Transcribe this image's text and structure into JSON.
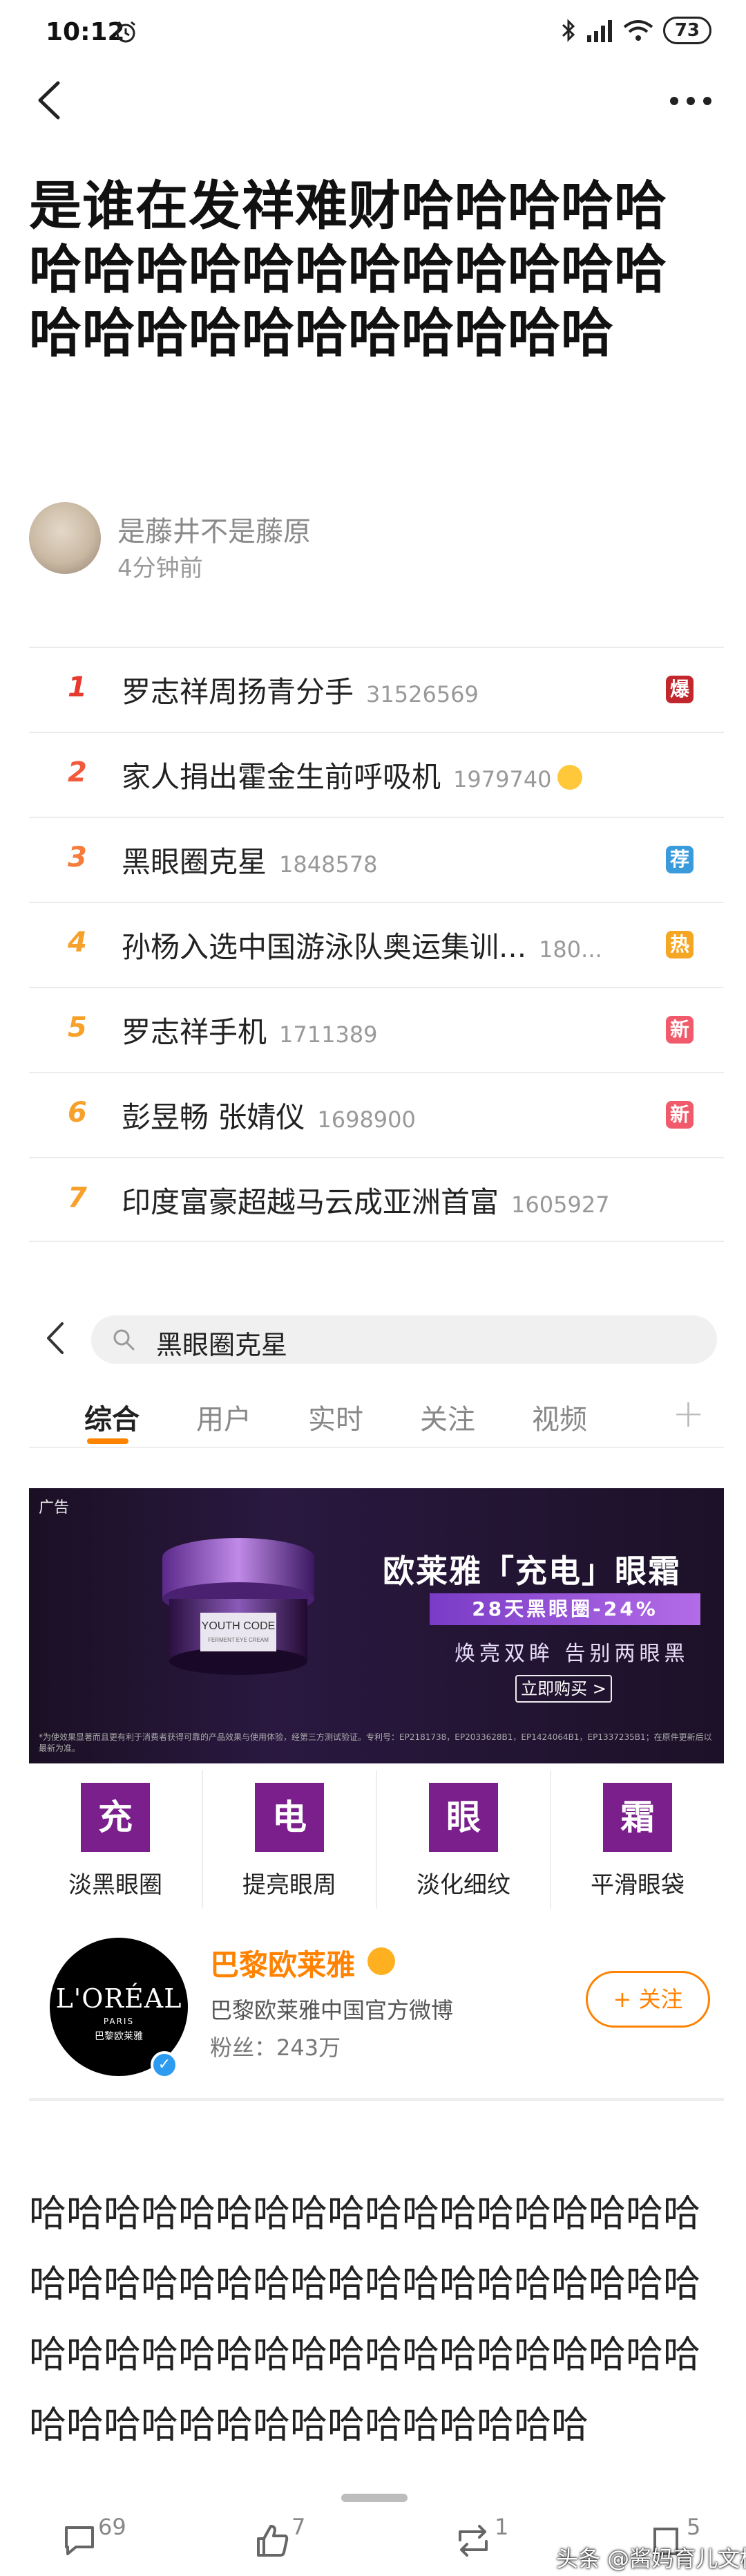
{
  "status_bar": {
    "time": "10:12",
    "battery": "73"
  },
  "post": {
    "title": "是谁在发祥难财哈哈哈哈哈哈哈哈哈哈哈哈哈哈哈哈哈哈哈哈哈哈哈哈哈哈哈哈",
    "author": "是藤井不是藤原",
    "time_ago": "4分钟前",
    "body": "哈哈哈哈哈哈哈哈哈哈哈哈哈哈哈哈哈哈哈哈哈哈哈哈哈哈哈哈哈哈哈哈哈哈哈哈哈哈哈哈哈哈哈哈哈哈哈哈哈哈哈哈哈哈哈哈哈哈哈哈哈哈哈哈哈哈哈哈哈"
  },
  "hot_list": [
    {
      "rank": "1",
      "text": "罗志祥周扬青分手",
      "count": "31526569",
      "badge": "爆",
      "rank_color": "#e8392f",
      "badge_color": "#c1272d"
    },
    {
      "rank": "2",
      "text": "家人捐出霍金生前呼吸机",
      "count": "1979740",
      "badge": "",
      "rank_color": "#f25a3c",
      "badge_color": ""
    },
    {
      "rank": "3",
      "text": "黑眼圈克星",
      "count": "1848578",
      "badge": "荐",
      "rank_color": "#f77b3a",
      "badge_color": "#3a9bdc"
    },
    {
      "rank": "4",
      "text": "孙杨入选中国游泳队奥运集训...",
      "count": "180...",
      "badge": "热",
      "rank_color": "#f7a02a",
      "badge_color": "#f5a623"
    },
    {
      "rank": "5",
      "text": "罗志祥手机",
      "count": "1711389",
      "badge": "新",
      "rank_color": "#f7a02a",
      "badge_color": "#f05a6a"
    },
    {
      "rank": "6",
      "text": "彭昱畅 张婧仪",
      "count": "1698900",
      "badge": "新",
      "rank_color": "#f7a02a",
      "badge_color": "#f05a6a"
    },
    {
      "rank": "7",
      "text": "印度富豪超越马云成亚洲首富",
      "count": "1605927",
      "badge": "",
      "rank_color": "#f7a02a",
      "badge_color": ""
    }
  ],
  "embed": {
    "search_query": "黑眼圈克星",
    "tabs": [
      "综合",
      "用户",
      "实时",
      "关注",
      "视频"
    ],
    "tab_plus": "+",
    "ad": {
      "label": "广告",
      "product": "YOUTH CODE",
      "product_sub": "FERMENT EYE CREAM",
      "headline": "欧莱雅「充电」眼霜",
      "stripe": "28天黑眼圈-24%",
      "sub": "焕亮双眸 告别两眼黑",
      "cta": "立即购买 >",
      "fine": "*为使效果显著而且更有利于消费者获得可靠的产品效果与使用体验，经第三方测试验证。专利号：EP2181738，EP2033628B1，EP1424064B1，EP1337235B1；在原件更新后以最新为准。"
    },
    "features": [
      {
        "char": "充",
        "label": "淡黑眼圈"
      },
      {
        "char": "电",
        "label": "提亮眼周"
      },
      {
        "char": "眼",
        "label": "淡化细纹"
      },
      {
        "char": "霜",
        "label": "平滑眼袋"
      }
    ],
    "brand": {
      "logo_main": "L'ORÉAL",
      "logo_sub": "PARIS",
      "logo_cn": "巴黎欧莱雅",
      "name": "巴黎欧莱雅",
      "desc": "巴黎欧莱雅中国官方微博",
      "fans": "粉丝：243万",
      "follow": "+ 关注",
      "verified": "✓"
    }
  },
  "actions": {
    "comments": "69",
    "likes": "7",
    "reposts": "1",
    "shares": "5"
  },
  "watermark": "头条 @酱妈育儿文档"
}
